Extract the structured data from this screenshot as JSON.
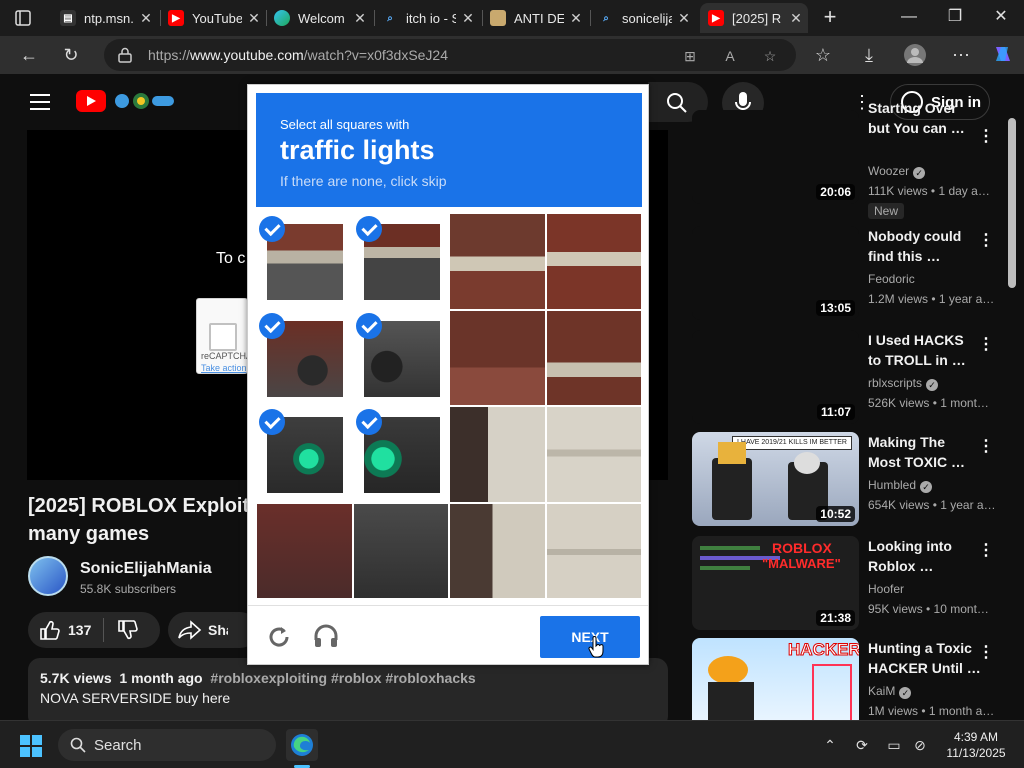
{
  "browser": {
    "tabs": [
      {
        "title": "ntp.msn.",
        "favicon": "msn-icon"
      },
      {
        "title": "YouTube",
        "favicon": "youtube-icon"
      },
      {
        "title": "Welcom",
        "favicon": "edge-icon"
      },
      {
        "title": "itch io - S",
        "favicon": "search-icon"
      },
      {
        "title": "ANTI DE",
        "favicon": "image-icon"
      },
      {
        "title": "sonicelija",
        "favicon": "search-icon"
      },
      {
        "title": "[2025] R",
        "favicon": "youtube-icon",
        "active": true
      }
    ],
    "url_prefix": "https://",
    "url_host": "www.youtube.com",
    "url_path": "/watch?v=x0f3dxSeJ24",
    "window_controls": {
      "minimize": "—",
      "restore": "❐",
      "close": "✕"
    }
  },
  "youtube": {
    "sign_in": "Sign in",
    "player_text": "To c",
    "recaptcha_mini": {
      "label": "reCAPTCHA",
      "link": "Take action"
    },
    "video_title": "[2025] ROBLOX Exploiting",
    "video_title_line2": "many games",
    "channel_name": "SonicElijahMania",
    "subscribers": "55.8K subscribers",
    "likes": "137",
    "share": "Share",
    "description": {
      "views": "5.7K views",
      "age": "1 month ago",
      "tags": "#robloxexploiting #roblox #robloxhacks",
      "text": "NOVA SERVERSIDE buy here"
    },
    "sidebar": [
      {
        "title1": "Starting Over",
        "title2": "but You can …",
        "channel": "Woozer",
        "verified": true,
        "meta": "111K views • 1 day a…",
        "duration": "20:06",
        "badge": "New"
      },
      {
        "title1": "Nobody could",
        "title2": "find this …",
        "channel": "Feodoric",
        "verified": false,
        "meta": "1.2M views • 1 year a…",
        "duration": "13:05"
      },
      {
        "title1": "I Used HACKS",
        "title2": "to TROLL in …",
        "channel": "rblxscripts",
        "verified": true,
        "meta": "526K views • 1 mont…",
        "duration": "11:07"
      },
      {
        "title1": "Making The",
        "title2": "Most TOXIC …",
        "channel": "Humbled",
        "verified": true,
        "meta": "654K views • 1 year a…",
        "duration": "10:52",
        "thumb_text": "I HAVE 2019/21 KILLS IM BETTER"
      },
      {
        "title1": "Looking into",
        "title2": "Roblox …",
        "channel": "Hoofer",
        "verified": false,
        "meta": "95K views • 10 mont…",
        "duration": "21:38",
        "thumb_text1": "ROBLOX",
        "thumb_text2": "\"MALWARE\""
      },
      {
        "title1": "Hunting a Toxic",
        "title2": "HACKER Until …",
        "channel": "KaiM",
        "verified": true,
        "meta": "1M views • 1 month a…",
        "duration": "",
        "thumb_text": "HACKER"
      }
    ]
  },
  "captcha": {
    "instruction": "Select all squares with",
    "target": "traffic lights",
    "hint": "If there are none, click skip",
    "next_label": "NEXT",
    "selected_tiles": [
      0,
      1,
      4,
      5,
      8,
      9
    ]
  },
  "taskbar": {
    "search_label": "Search",
    "time": "4:39 AM",
    "date": "11/13/2025"
  },
  "colors": {
    "captcha_blue": "#1a73e8",
    "youtube_red": "#ff0000",
    "page_bg": "#0f0f0f"
  }
}
